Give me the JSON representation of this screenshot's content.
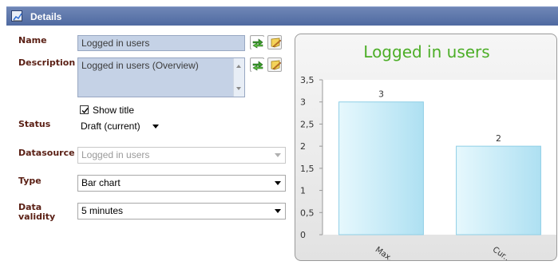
{
  "header": {
    "title": "Details",
    "icon": "chart-icon"
  },
  "form": {
    "name_label": "Name",
    "name_value": "Logged in users",
    "description_label": "Description",
    "description_value": "Logged in users (Overview)",
    "show_title_label": "Show title",
    "show_title_checked": true,
    "status_label": "Status",
    "status_value": "Draft (current)",
    "datasource_label": "Datasource",
    "datasource_value": "Logged in users",
    "type_label": "Type",
    "type_value": "Bar chart",
    "validity_label_1": "Data",
    "validity_label_2": "validity",
    "validity_value": "5 minutes"
  },
  "icons": {
    "translate": "translate-arrows-icon",
    "edit": "edit-note-icon"
  },
  "colors": {
    "header": "#5a73a8",
    "label": "#5a1f14",
    "field_bg": "#c5d2e6",
    "chart_title": "#4cae27",
    "bar_fill": "#bfe9f7"
  },
  "chart_data": {
    "type": "bar",
    "title": "Logged in users",
    "categories": [
      "Max...",
      "Cur..."
    ],
    "values": [
      3,
      2
    ],
    "data_labels": [
      "3",
      "2"
    ],
    "ylim": [
      0,
      3.5
    ],
    "yticks": [
      "0",
      "0,5",
      "1",
      "1,5",
      "2",
      "2,5",
      "3",
      "3,5"
    ],
    "grid": false,
    "legend": "none"
  }
}
